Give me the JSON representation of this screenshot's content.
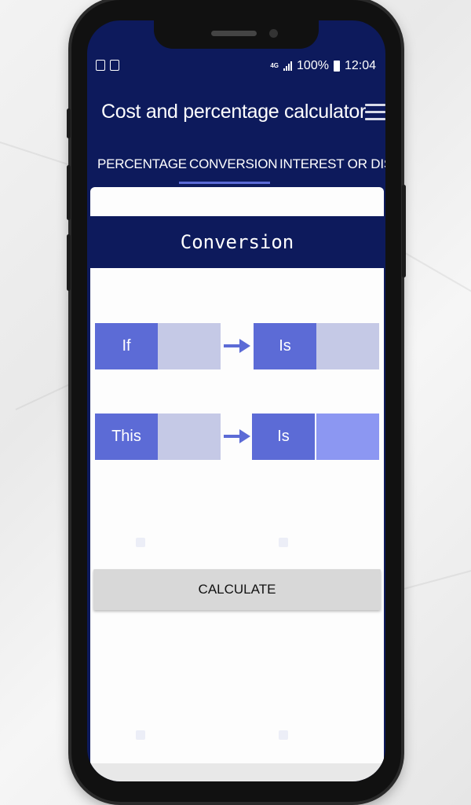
{
  "status_bar": {
    "network": "4G",
    "battery": "100%",
    "time": "12:04"
  },
  "app_bar": {
    "title": "Cost and percentage calculator",
    "menu_icon": "hamburger-menu-icon"
  },
  "tabs": [
    {
      "label": "PERCENTAGE",
      "selected": false
    },
    {
      "label": "CONVERSION",
      "selected": true
    },
    {
      "label": "INTEREST OR DISCO",
      "selected": false
    }
  ],
  "conversion": {
    "header": "Conversion",
    "row1": {
      "label_left": "If",
      "value_left": "",
      "label_right": "Is",
      "value_right": ""
    },
    "row2": {
      "label_left": "This",
      "value_left": "",
      "label_right": "Is",
      "value_right": ""
    },
    "calculate_label": "CALCULATE"
  },
  "colors": {
    "primary_dark": "#0d1a5c",
    "accent": "#5c6bd6",
    "field_bg": "#c5c9e6",
    "result_bg": "#8c97f2",
    "button_bg": "#d8d8d8"
  }
}
